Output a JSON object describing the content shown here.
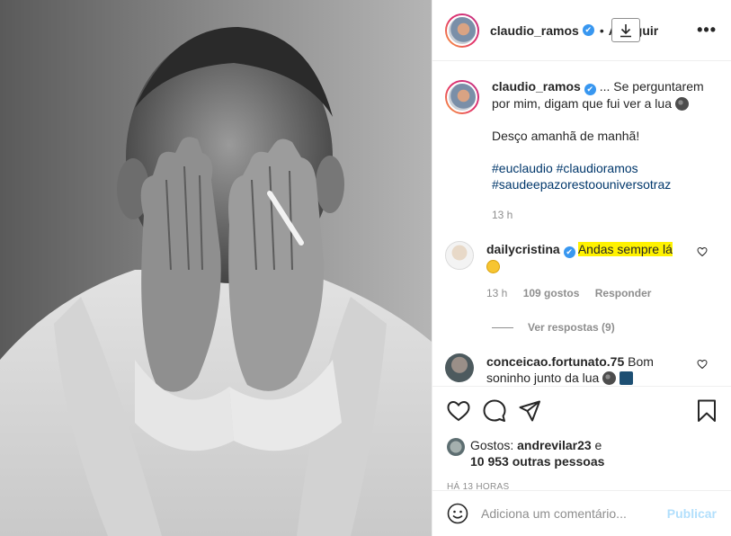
{
  "header": {
    "username": "claudio_ramos",
    "verified_mark": "✔",
    "separator": "•",
    "follow_label": "A seguir",
    "more_label": "•••"
  },
  "caption": {
    "username": "claudio_ramos",
    "text_line1": "... Se perguntarem por mim, digam que fui ver a lua",
    "text_line2": "Desço amanhã de manhã!",
    "hashtags": "#euclaudio #claudioramos #saudeepazorestoouniversotraz",
    "time": "13 h"
  },
  "comments": [
    {
      "username": "dailycristina",
      "text": "Andas sempre lá",
      "time": "13 h",
      "likes": "109 gostos",
      "reply_label": "Responder",
      "view_replies": "Ver respostas (9)"
    },
    {
      "username": "conceicao.fortunato.75",
      "text": "Bom soninho junto da lua"
    }
  ],
  "likes": {
    "prefix": "Gostos:",
    "user": "andrevilar23",
    "conj": "e",
    "others": "10 953 outras pessoas"
  },
  "timestamp": "HÁ 13 HORAS",
  "add_comment": {
    "placeholder": "Adiciona um comentário...",
    "publish": "Publicar"
  },
  "colors": {
    "link": "#00376b",
    "verified": "#3897f0",
    "highlight": "#fff200",
    "publish": "#b2dffc"
  },
  "icons": [
    "heart-icon",
    "comment-icon",
    "share-icon",
    "bookmark-icon",
    "download-icon",
    "smiley-icon",
    "moon-emoji",
    "grin-emoji"
  ]
}
